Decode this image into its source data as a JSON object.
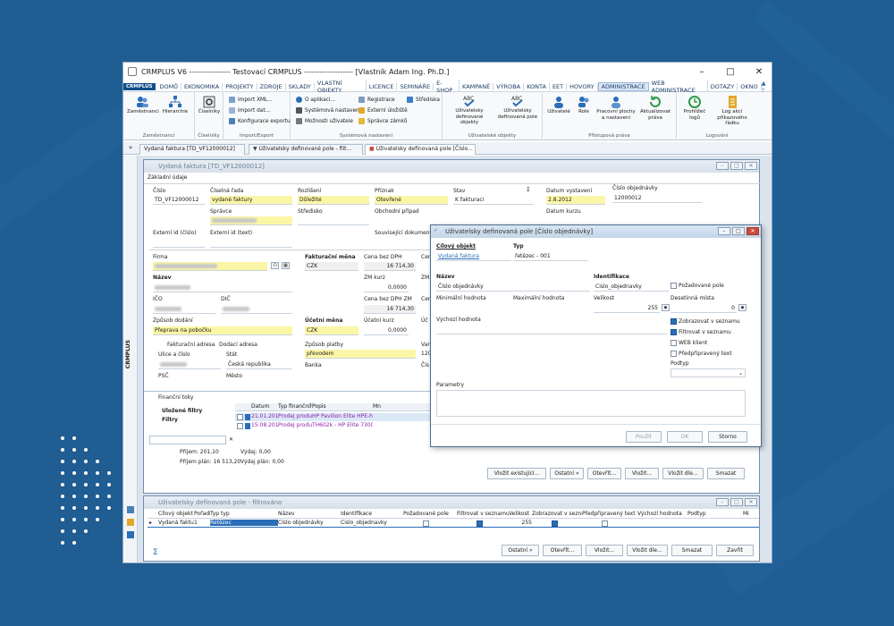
{
  "window": {
    "title": "CRMPLUS V6 ---------------- Testovací CRMPLUS ------------------- [Vlastník Adam Ing. Ph.D.]",
    "minimize": "–",
    "maximize": "□",
    "close": "✕"
  },
  "menu": {
    "logo": "CRMPLUS",
    "items": [
      "DOMŮ",
      "EKONOMIKA",
      "PROJEKTY",
      "ZDROJE",
      "SKLADY",
      "VLASTNÍ OBJEKTY",
      "LICENCE",
      "SEMINÁŘE",
      "E-SHOP",
      "KAMPANĚ",
      "VÝROBA",
      "KONTA",
      "EET",
      "HOVORY",
      "ADMINISTRACE",
      "WEB ADMINISTRACE",
      "DOTAZY",
      "OKNO"
    ],
    "active_index": 14,
    "extra": "▲ ?"
  },
  "ribbon": {
    "groups": [
      {
        "label": "Zaměstnanci",
        "buttons": [
          "Zaměstnanci",
          "Hierarchie"
        ]
      },
      {
        "label": "Číselníky",
        "buttons": [
          "Číselníky"
        ]
      },
      {
        "label": "Import/Export",
        "items": [
          "Import XML...",
          "Import dat...",
          "Konfigurace exportu"
        ]
      },
      {
        "label": "Systémová nastavení",
        "items": [
          "O aplikaci...",
          "Systémová nastavení",
          "Možnosti uživatele",
          "Registrace",
          "Externí úložiště",
          "Správce zámků",
          "Střediska"
        ]
      },
      {
        "label": "Uživatelské objekty",
        "buttons": [
          "Uživatelsky definované objekty",
          "Uživatelsky definovaná pole"
        ]
      },
      {
        "label": "Přístupová práva",
        "buttons": [
          "Uživatelé",
          "Role",
          "Pracovní plochy a nastavení",
          "Aktualizovat práva"
        ]
      },
      {
        "label": "Logování",
        "buttons": [
          "Prohlížeč logů",
          "Log akcí příkazového řádku"
        ]
      }
    ]
  },
  "doctabs": [
    "Vydaná faktura [TD_VF12000012]",
    "Uživatelsky definované pole - filt...",
    "Uživatelsky definovaná pole [Číslo..."
  ],
  "invoice": {
    "title": "Vydaná faktura [TD_VF12000012]",
    "tab": "Základní údaje",
    "labels": {
      "cislo": "Číslo",
      "ciselna_rada": "Číselná řada",
      "rozliseni": "Rozlišení",
      "priznak": "Příznak",
      "stav": "Stav",
      "datum_vystaveni": "Datum vystavení",
      "cislo_objednavky": "Číslo objednávky",
      "spravce": "Správce",
      "stredisko": "Středisko",
      "obchodni_pripad": "Obchodní případ",
      "datum_kurzu": "Datum kurzu",
      "externi_id_cislo": "Externí id (číslo)",
      "externi_id_text": "Externí id (text)",
      "souvisejici": "Související dokument",
      "firma": "Firma",
      "nazev": "Název",
      "ico": "IČO",
      "dic": "DIČ",
      "zpusob_dodani": "Způsob dodání",
      "fakturacni_mena": "Fakturační měna",
      "cena_bez_dph": "Cena bez DPH",
      "zm_kurz": "ZM kurz",
      "cena_bez_dph_zm": "Cena bez DPH ZM",
      "ucetni_mena": "Účetní měna",
      "ucetni_kurz": "Účetní kurz",
      "zpusob_platby": "Způsob platby",
      "banka": "Banka",
      "fakturacni_adresa": "Fakturační adresa",
      "dodaci_adresa": "Dodací adresa",
      "ulice": "Ulice a číslo",
      "stat": "Stát",
      "psc": "PSČ",
      "mesto": "Město",
      "sigma": "Σ"
    },
    "values": {
      "cislo": "TD_VF12000012",
      "ciselna_rada": "vydané faktury",
      "rozliseni": "Důležité",
      "priznak": "Otevřené",
      "stav": "K fakturaci",
      "datum_vystaveni": "2.8.2012",
      "cislo_objednavky": "12000012",
      "fakturacni_mena": "CZK",
      "cena_bez_dph": "16 714,30",
      "zm_kurz": "0,0000",
      "cena_bez_dph_zm": "16 714,30",
      "zpusob_dodani": "Přeprava na pobočku",
      "ucetni_mena": "CZK",
      "ucetni_kurz": "0,0000",
      "zpusob_platby": "převodem",
      "stat": "Česká republika",
      "right_c": "Cen",
      "right_z": "ZM",
      "right_ce": "Cen",
      "right_u": "Úč",
      "right_v": "Var",
      "right_vv": "120",
      "right_cis": "Čís"
    }
  },
  "finance": {
    "title": "Finanční toky",
    "tree": [
      "Uložené filtry",
      "Filtry"
    ],
    "headers": [
      "Datum",
      "Typ finančního toku",
      "Popis",
      "Mn"
    ],
    "rows": [
      [
        "21.01.2013",
        "Prodej produktu",
        "HP Pavilion Elite HPE-h"
      ],
      [
        "15.08.2012",
        "Prodej produktu",
        "TH602k - HP Elite 7300 N"
      ]
    ],
    "search_clear": "✕",
    "sum_prijem": "Příjem: 201,10",
    "sum_vydaj": "Výdaj: 0,00",
    "sum_prijem_plan": "Příjem plán: 16 513,20",
    "sum_vydaj_plan": "Výdaj plán: 0,00",
    "buttons": [
      "Vložit existující...",
      "Ostatní »",
      "Otevřít...",
      "Vložit...",
      "Vložit dle...",
      "Smazat"
    ]
  },
  "dialog": {
    "title": "Uživatelsky definovaná pole [Číslo objednávky]",
    "labels": {
      "cilovy": "Cílový objekt",
      "typ": "Typ",
      "nazev": "Název",
      "identifikace": "Identifikace",
      "min": "Minimální hodnota",
      "max": "Maximální hodnota",
      "velikost": "Velikost",
      "desetinna": "Desetinná místa",
      "vychozi": "Výchozí hodnota",
      "podtyp": "Podtyp",
      "parametry": "Parametry"
    },
    "values": {
      "cilovy": "Vydaná faktura",
      "typ": "řetězec - 001",
      "nazev": "Číslo objednávky",
      "identifikace": "Cislo_objednavky",
      "velikost": "255",
      "desetinna": "0"
    },
    "checks": [
      {
        "label": "Požadované pole",
        "on": false
      },
      {
        "label": "Zobrazovat v seznamu",
        "on": true
      },
      {
        "label": "Filtrovat v seznamu",
        "on": true
      },
      {
        "label": "WEB klient",
        "on": false
      },
      {
        "label": "Předpřipravený text",
        "on": false
      }
    ],
    "buttons": {
      "pouzit": "Použít",
      "ok": "OK",
      "storno": "Storno"
    }
  },
  "udp_list": {
    "title": "Uživatelsky definovaná pole - filtrováno",
    "headers": [
      "Cílový objekt",
      "Pořadí",
      "Typ typ",
      "Název",
      "Identifikace",
      "Požadované pole",
      "Filtrovat v seznamu",
      "Velikost",
      "Zobrazovat v seznamu",
      "Předpřipravený text",
      "Výchozí hodnota",
      "Podtyp",
      "Mi"
    ],
    "row": {
      "cilovy": "Vydaná faktura",
      "poradi": "1",
      "typ": "Řetězec",
      "nazev": "Číslo objednávky",
      "identifikace": "Cislo_objednavky",
      "velikost": "255"
    },
    "sigma": "Σ",
    "buttons": [
      "Ostatní »",
      "Otevřít...",
      "Vložit...",
      "Vložit dle...",
      "Smazat",
      "Zavřít"
    ]
  },
  "colors": {
    "accent": "#2a6db8",
    "yellow_field": "#fbf6a6",
    "background": "#1f5d92",
    "close": "#c94d3f"
  }
}
